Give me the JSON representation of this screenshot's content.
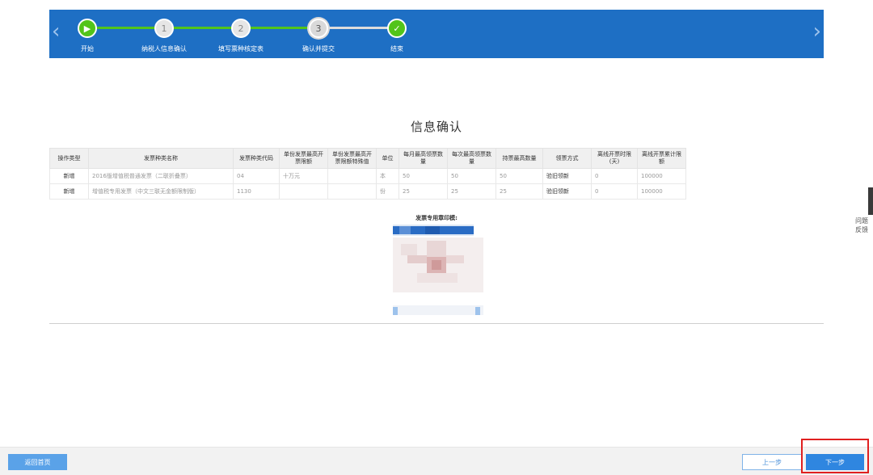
{
  "steps": [
    {
      "label": "开始",
      "num": "▶"
    },
    {
      "label": "纳税人信息确认",
      "num": "1"
    },
    {
      "label": "填写票种核定表",
      "num": "2"
    },
    {
      "label": "确认并提交",
      "num": "3"
    },
    {
      "label": "结束",
      "num": "✓"
    }
  ],
  "title": "信息确认",
  "table": {
    "headers": [
      "操作类型",
      "发票种类名称",
      "发票种类代码",
      "单份发票最高开票限额",
      "单份发票最高开票限额特殊值",
      "单位",
      "每月最高领票数量",
      "每次最高领票数量",
      "持票最高数量",
      "领票方式",
      "离线开票时限(天)",
      "离线开票累计限额"
    ],
    "rows": [
      [
        "新增",
        "2016版增值税普通发票（二联折叠票）",
        "04",
        "十万元",
        "",
        "本",
        "50",
        "50",
        "50",
        "验旧领新",
        "0",
        "100000"
      ],
      [
        "新增",
        "增值税专用发票（中文三联无金额限制版）",
        "1130",
        "",
        "",
        "份",
        "25",
        "25",
        "25",
        "验旧领新",
        "0",
        "100000"
      ]
    ]
  },
  "stamp": {
    "label": "发票专用章印模:"
  },
  "feedback": "问题反馈",
  "buttons": {
    "home": "返回首页",
    "prev": "上一步",
    "next": "下一步"
  },
  "colors": {
    "header": "#1e6fc4",
    "done": "#52c41a",
    "accent": "#2f86e0",
    "highlight": "#e02020"
  }
}
